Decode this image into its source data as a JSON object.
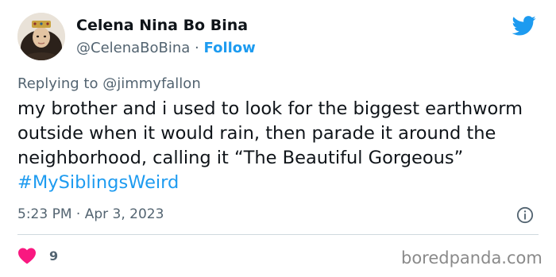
{
  "author": {
    "name": "Celena Nina Bo Bina",
    "handle": "@CelenaBoBina",
    "separator": "·",
    "follow_label": "Follow",
    "avatar_icon": "portrait-avatar"
  },
  "header": {
    "brand_icon": "twitter-bird-icon",
    "brand_color": "#1d9bf0"
  },
  "reply": {
    "prefix": "Replying to",
    "mention": "@jimmyfallon"
  },
  "tweet": {
    "text": "my brother and i used to look for the biggest earthworm outside when it would rain, then parade it around the neighborhood, calling it “The Beautiful Gorgeous”",
    "hashtag": "#MySiblingsWeird",
    "time": "5:23 PM",
    "separator": "·",
    "date": "Apr 3, 2023",
    "info_icon": "info-icon"
  },
  "engagement": {
    "like_icon": "heart-icon",
    "like_color": "#f91880",
    "likes": "9"
  },
  "watermark": "boredpanda.com",
  "colors": {
    "text": "#0f1419",
    "secondary": "#536471",
    "accent": "#1d9bf0",
    "divider": "#cfd9de"
  }
}
